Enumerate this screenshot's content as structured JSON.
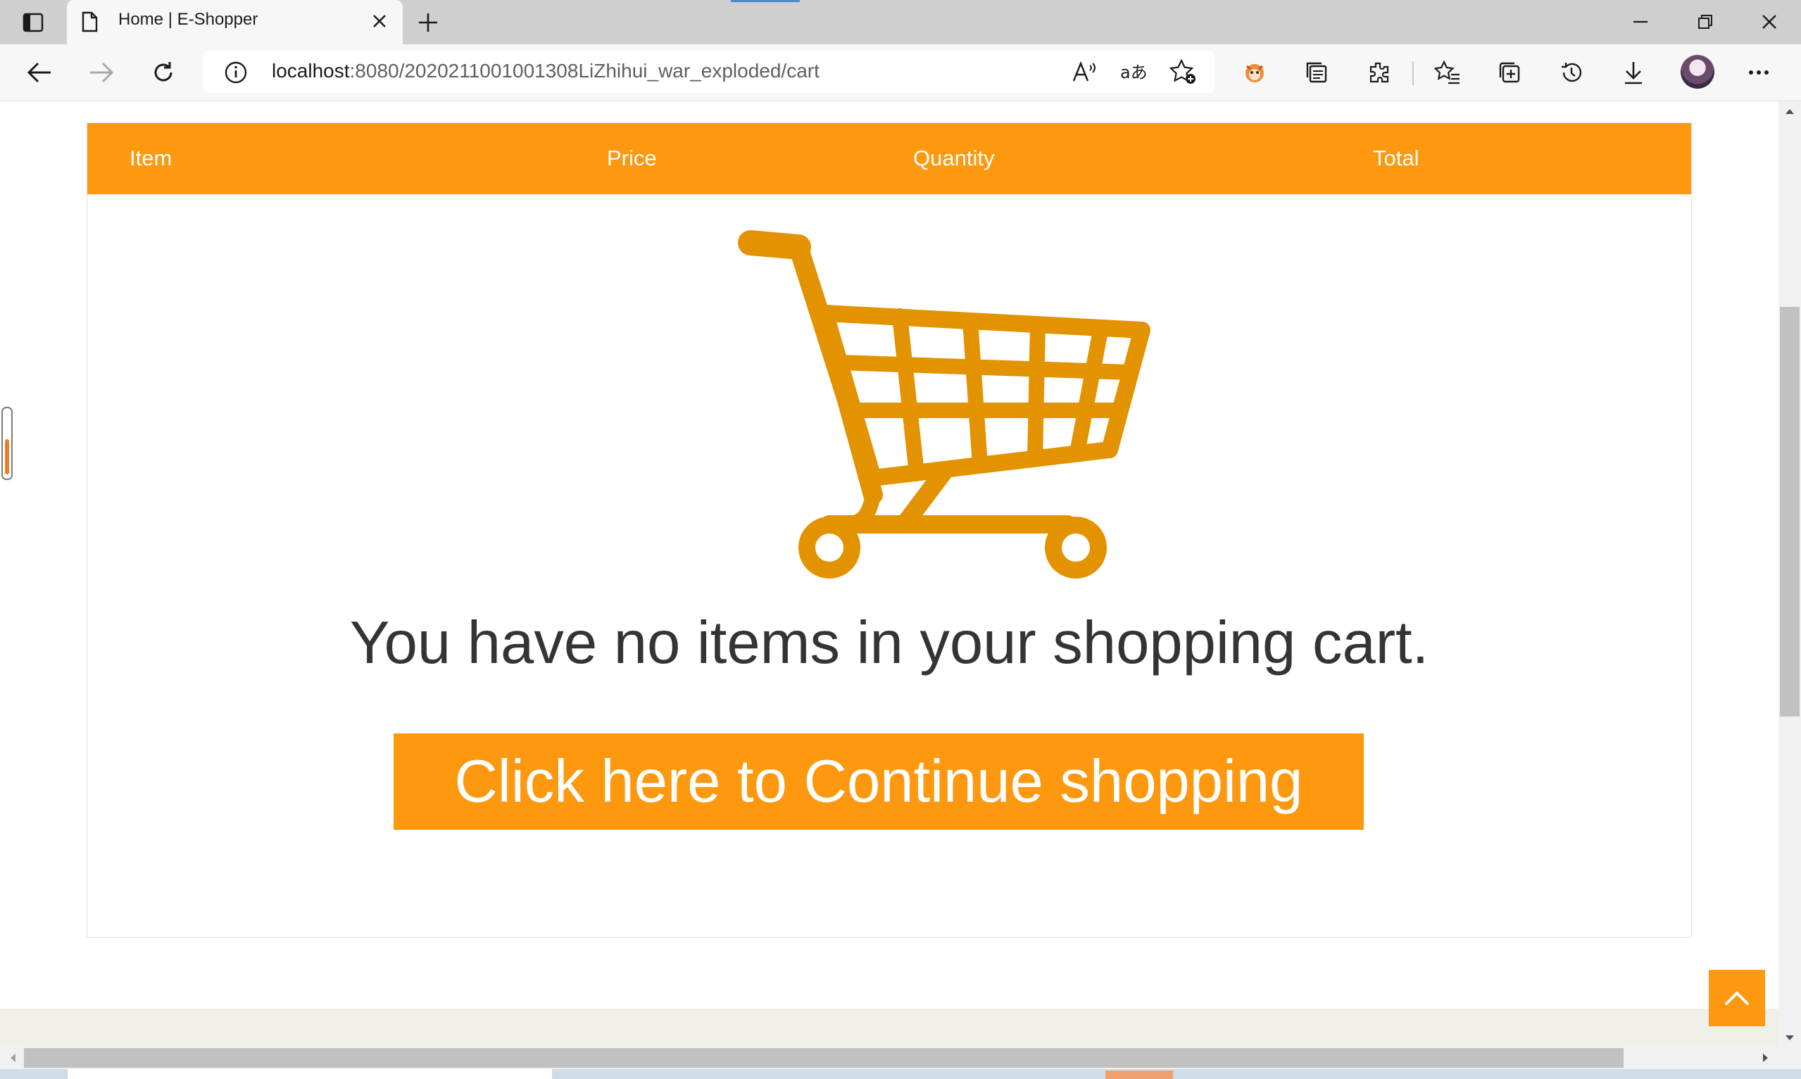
{
  "browser": {
    "tab_title": "Home | E-Shopper",
    "url_host": "localhost",
    "url_path": ":8080/2020211001001308LiZhihui_war_exploded/cart",
    "toolbar_icons": [
      "read-aloud-icon",
      "translate-icon",
      "add-favorite-icon",
      "extension-fox-icon",
      "collections-icon",
      "extensions-icon",
      "favorites-icon",
      "add-to-collections-icon",
      "history-icon",
      "downloads-icon",
      "profile-avatar",
      "more-icon"
    ]
  },
  "cart": {
    "columns": {
      "item": "Item",
      "price": "Price",
      "quantity": "Quantity",
      "total": "Total"
    },
    "empty_message": "You have no items in your shopping cart.",
    "continue_label": "Click here to Continue shopping"
  },
  "colors": {
    "accent": "#fe980f",
    "cart_icon": "#e39200",
    "text": "#363432"
  }
}
